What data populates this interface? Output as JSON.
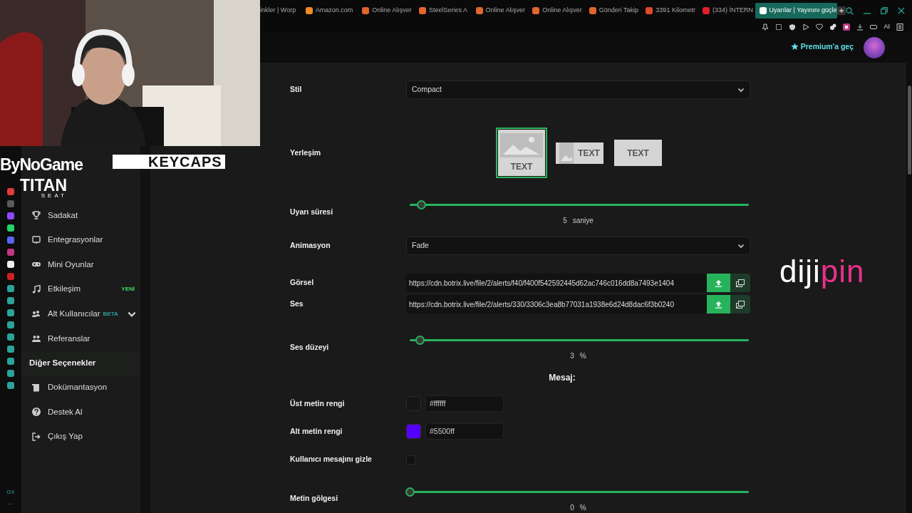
{
  "browser_tabs": [
    {
      "title": "inkler | Worp",
      "selected": false
    },
    {
      "title": "Amazon.com",
      "selected": false,
      "color": "#f08a24"
    },
    {
      "title": "Online Alışver",
      "selected": false,
      "color": "#e0662c"
    },
    {
      "title": "SteelSeries A",
      "selected": false,
      "color": "#e0662c"
    },
    {
      "title": "Online Alışver",
      "selected": false,
      "color": "#e0662c"
    },
    {
      "title": "Online Alışver",
      "selected": false,
      "color": "#e0662c"
    },
    {
      "title": "Gönderi Takip",
      "selected": false,
      "color": "#e0662c"
    },
    {
      "title": "3391 Kilometr",
      "selected": false,
      "color": "#e04a2c"
    },
    {
      "title": "(334) İNTERN",
      "selected": false,
      "color": "#e0202c"
    },
    {
      "title": "Uyarılar | Yayınını güçle",
      "selected": true,
      "color": "#ffffff"
    }
  ],
  "browser_toolbar": {
    "ai_label": "AI"
  },
  "gx_sidebar": {
    "label": "GX",
    "more": "···"
  },
  "header": {
    "premium": "Premium'a geç"
  },
  "sidebar": {
    "items": [
      {
        "label": "Sadakat"
      },
      {
        "label": "Entegrasyonlar"
      },
      {
        "label": "Mini Oyunlar"
      },
      {
        "label": "Etkileşim",
        "badge": "YENİ",
        "color": "#3ddc5f"
      },
      {
        "label": "Alt Kullanıcılar",
        "badge": "BETA",
        "color": "#2aa39a",
        "expanded": false
      }
    ],
    "more_items": [
      {
        "label": "Referanslar"
      }
    ],
    "section": "Diğer Seçenekler",
    "section_items": [
      {
        "label": "Dokümantasyon"
      },
      {
        "label": "Destek Al"
      },
      {
        "label": "Çıkış Yap"
      }
    ]
  },
  "form": [
    {
      "kind": "select",
      "label": "Stil",
      "value": "Compact"
    },
    {
      "kind": "layout",
      "label": "Yerleşim",
      "options": [
        {
          "kind": "stacked",
          "text": "TEXT",
          "selected": true
        },
        {
          "kind": "inline",
          "text": "TEXT",
          "selected": false
        },
        {
          "kind": "plain",
          "text": "TEXT",
          "selected": false
        }
      ]
    },
    {
      "kind": "slider",
      "label": "Uyarı süresi",
      "level": 0.034,
      "reading": "5",
      "unit": "saniye"
    },
    {
      "kind": "select",
      "label": "Animasyon",
      "value": "Fade"
    },
    {
      "kind": "file",
      "label": "Görsel",
      "value": "https://cdn.botrix.live/file/2/alerts/f40/f400f542592445d62ac746c016dd8a7493e1404"
    },
    {
      "kind": "file",
      "label": "Ses",
      "value": "https://cdn.botrix.live/file/2/alerts/330/3306c3ea8b77031a1938e6d24d8dac6f3b0240"
    },
    {
      "kind": "slider",
      "label": "Ses düzeyi",
      "level": 0.03,
      "reading": "3",
      "unit": "%"
    },
    {
      "kind": "heading",
      "label": "Mesaj:"
    },
    {
      "kind": "color",
      "label": "Üst metin rengi",
      "value": "#ffffff",
      "color": "#161616"
    },
    {
      "kind": "color",
      "label": "Alt metin rengi",
      "value": "#5500ff",
      "color": "#5500ff"
    },
    {
      "kind": "checkbox",
      "label": "Kullanıcı mesajını gizle",
      "checked": false
    },
    {
      "kind": "slider",
      "label": "Metin gölgesi",
      "level": 0,
      "reading": "0",
      "unit": "%"
    }
  ],
  "overlays": [
    {
      "kind": "bynogame",
      "text": "ByNoGame"
    },
    {
      "kind": "keycaps",
      "text": "KEYCAPS"
    },
    {
      "kind": "titan",
      "text": "TITAN",
      "sub": "SEAT"
    },
    {
      "kind": "dijipin",
      "parts": [
        "diji",
        "pin"
      ]
    }
  ]
}
